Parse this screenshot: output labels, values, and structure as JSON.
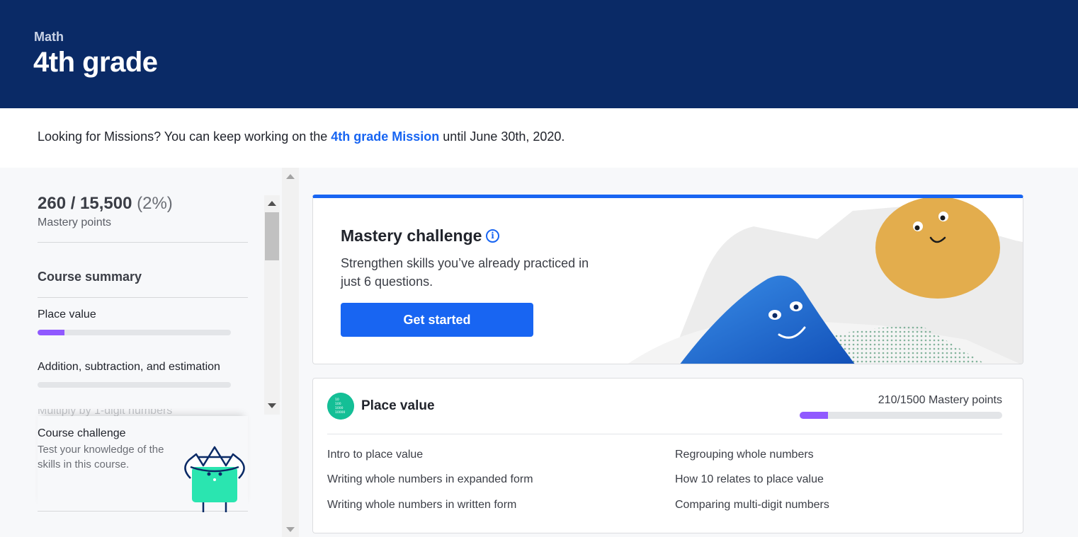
{
  "header": {
    "subject": "Math",
    "title": "4th grade"
  },
  "notice": {
    "prefix": "Looking for Missions? You can keep working on the ",
    "link": "4th grade Mission",
    "suffix": " until June 30th, 2020."
  },
  "sidebar": {
    "points": "260 / 15,500",
    "percent": "(2%)",
    "points_label": "Mastery points",
    "summary_title": "Course summary",
    "units": [
      {
        "label": "Place value",
        "progress": 0.14
      },
      {
        "label": "Addition, subtraction, and estimation",
        "progress": 0
      }
    ],
    "faded_unit": "Multiply by 1-digit numbers",
    "challenge": {
      "title": "Course challenge",
      "description": "Test your knowledge of the skills in this course."
    }
  },
  "mastery": {
    "title": "Mastery challenge",
    "description": "Strengthen skills you’ve already practiced in just 6 questions.",
    "button": "Get started"
  },
  "unit": {
    "title": "Place value",
    "points": "210/1500 Mastery points",
    "progress": 0.14,
    "icon_text": [
      "10",
      "100",
      "1000",
      "10000"
    ],
    "lessons": [
      "Intro to place value",
      "Writing whole numbers in expanded form",
      "Writing whole numbers in written form",
      "Regrouping whole numbers",
      "How 10 relates to place value",
      "Comparing multi-digit numbers"
    ]
  },
  "colors": {
    "header": "#0a2a66",
    "accent": "#1865f2",
    "progress": "#9059ff"
  }
}
